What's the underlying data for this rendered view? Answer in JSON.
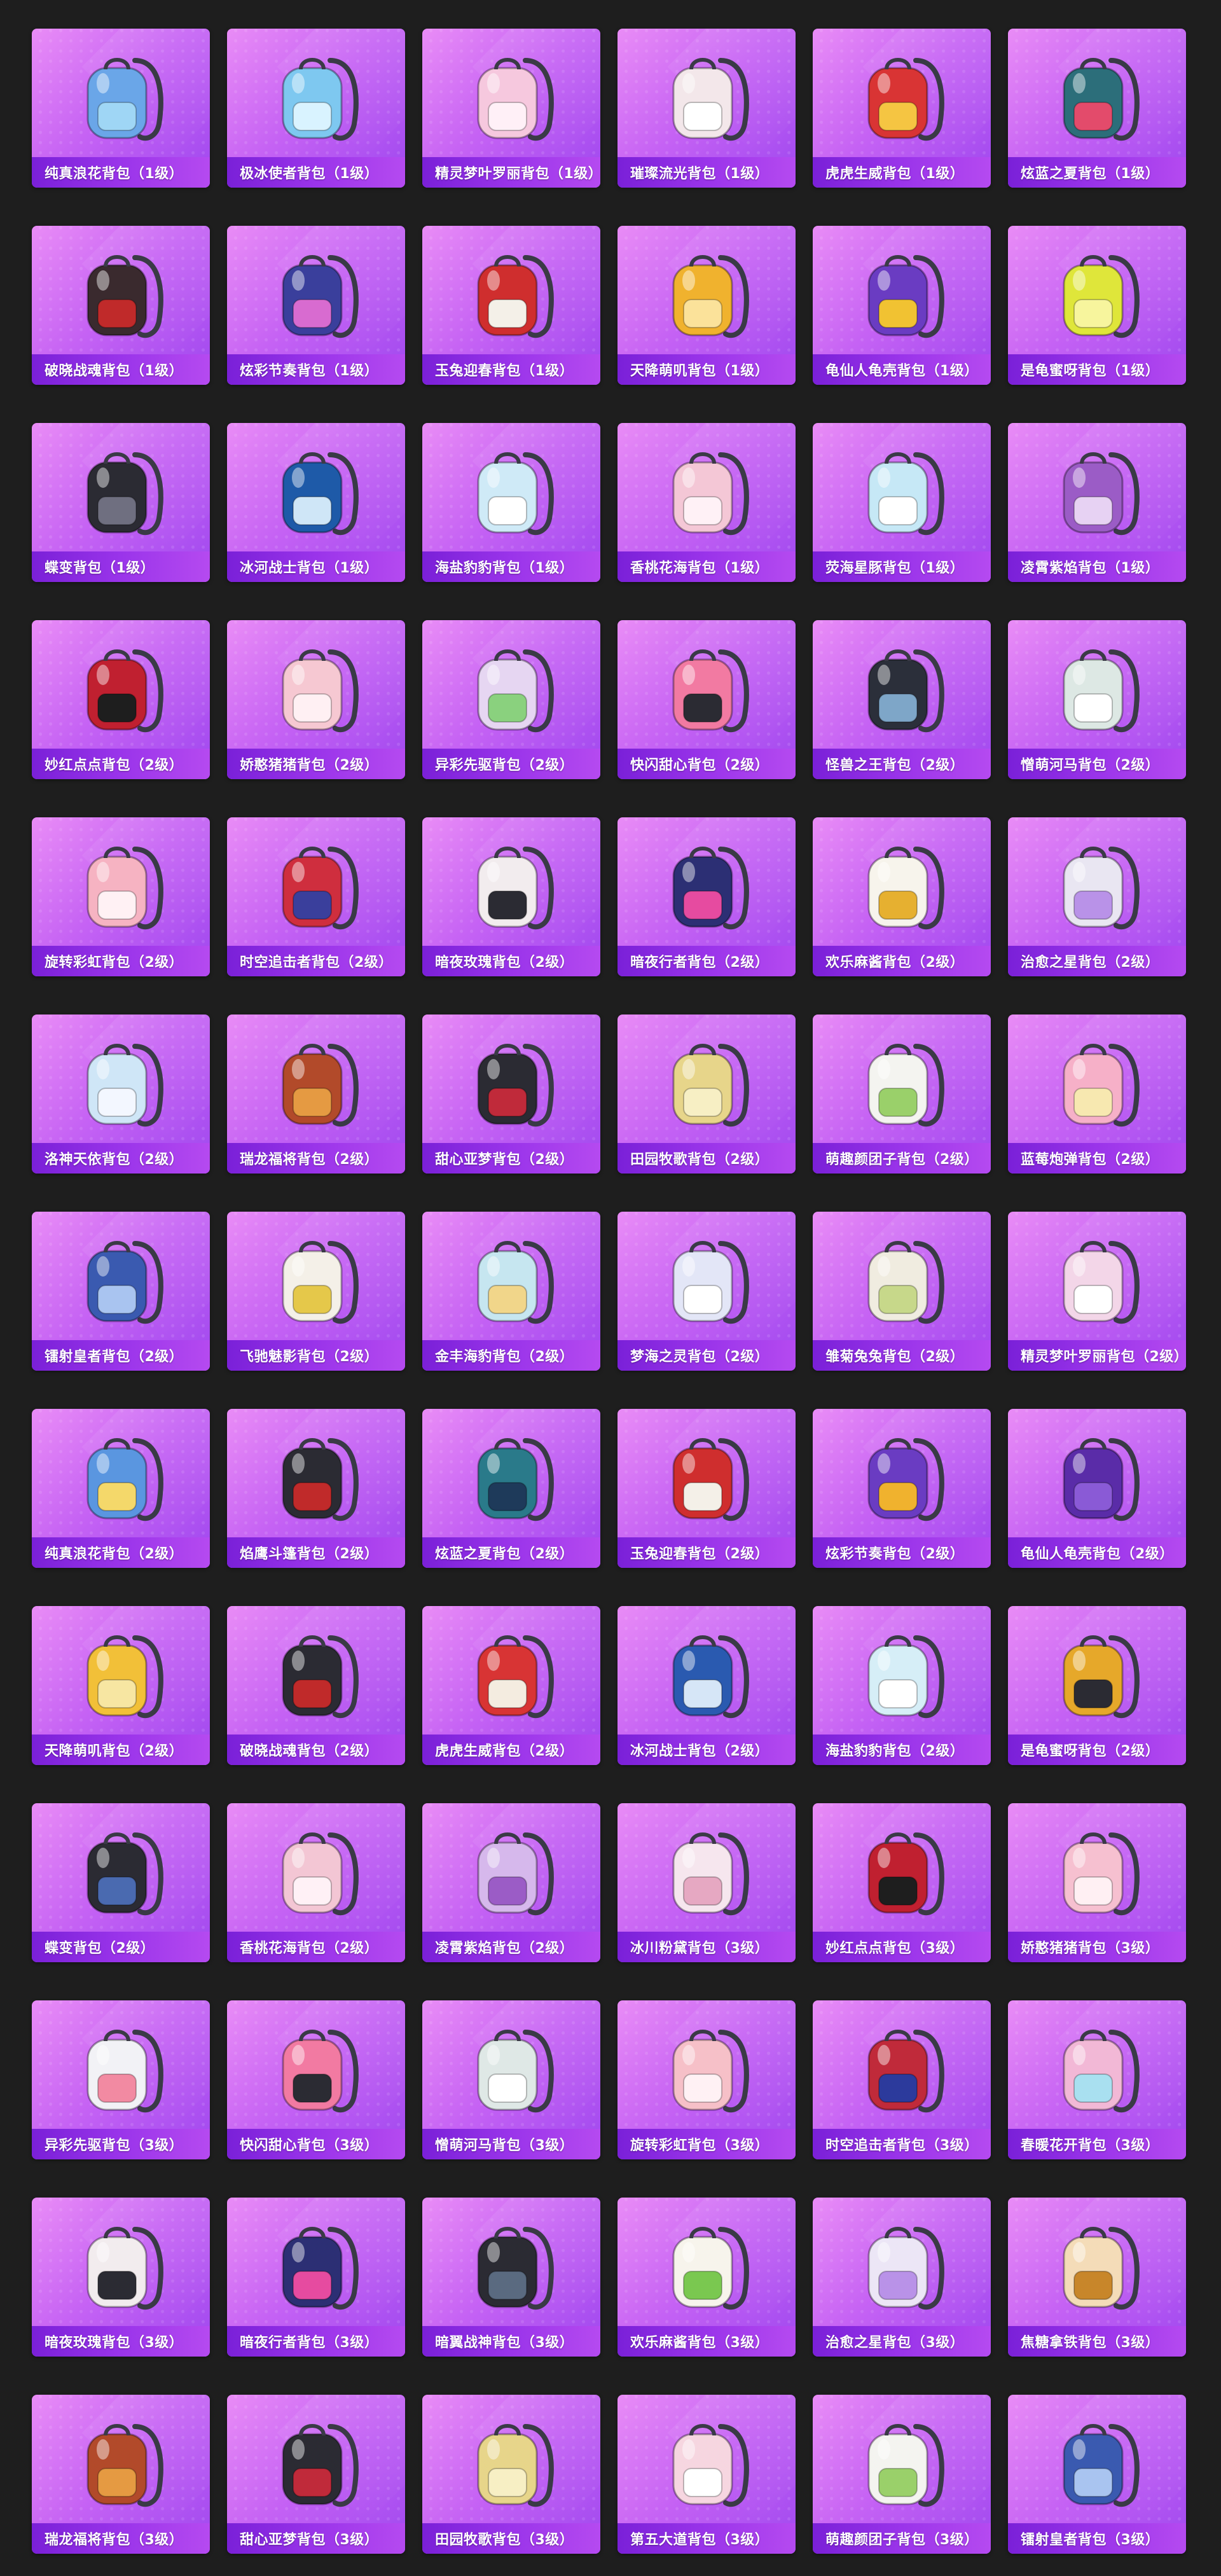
{
  "items": [
    {
      "name": "纯真浪花背包（1级）",
      "primary": "#6aa6e8",
      "secondary": "#9fd6f5"
    },
    {
      "name": "极冰使者背包（1级）",
      "primary": "#7ec8f0",
      "secondary": "#d9f3ff"
    },
    {
      "name": "精灵梦叶罗丽背包（1级）",
      "primary": "#f6c8de",
      "secondary": "#fff0f7"
    },
    {
      "name": "璀璨流光背包（1级）",
      "primary": "#f3e7ea",
      "secondary": "#ffffff"
    },
    {
      "name": "虎虎生威背包（1级）",
      "primary": "#d93434",
      "secondary": "#f5c542"
    },
    {
      "name": "炫蓝之夏背包（1级）",
      "primary": "#2c6e7a",
      "secondary": "#e34b6b"
    },
    {
      "name": "破晓战魂背包（1级）",
      "primary": "#3a2a2e",
      "secondary": "#c02a2a"
    },
    {
      "name": "炫彩节奏背包（1级）",
      "primary": "#3a3f9c",
      "secondary": "#d86bd0"
    },
    {
      "name": "玉兔迎春背包（1级）",
      "primary": "#cf2e2e",
      "secondary": "#f4f0e8"
    },
    {
      "name": "天降萌叽背包（1级）",
      "primary": "#f0b22e",
      "secondary": "#fbe29a"
    },
    {
      "name": "龟仙人龟壳背包（1级）",
      "primary": "#6a3cc2",
      "secondary": "#f1c232"
    },
    {
      "name": "是龟蜜呀背包（1级）",
      "primary": "#dfe63a",
      "secondary": "#f7f59d"
    },
    {
      "name": "蝶变背包（1级）",
      "primary": "#2b2b33",
      "secondary": "#6f6f80"
    },
    {
      "name": "冰河战士背包（1级）",
      "primary": "#1e5aa8",
      "secondary": "#cfe6f7"
    },
    {
      "name": "海盐豹豹背包（1级）",
      "primary": "#cfeaf7",
      "secondary": "#ffffff"
    },
    {
      "name": "香桃花海背包（1级）",
      "primary": "#f4c7d6",
      "secondary": "#fff1f6"
    },
    {
      "name": "荧海星豚背包（1级）",
      "primary": "#c6e8f6",
      "secondary": "#ffffff"
    },
    {
      "name": "凌霄紫焰背包（1级）",
      "primary": "#9b5cc6",
      "secondary": "#e7d2f3"
    },
    {
      "name": "妙红点点背包（2级）",
      "primary": "#c02030",
      "secondary": "#1e1e1e"
    },
    {
      "name": "娇憨猪猪背包（2级）",
      "primary": "#f6c8d2",
      "secondary": "#fff0f3"
    },
    {
      "name": "异彩先驱背包（2级）",
      "primary": "#e6d6f2",
      "secondary": "#8ad17e"
    },
    {
      "name": "快闪甜心背包（2级）",
      "primary": "#f27aa2",
      "secondary": "#2b2b33"
    },
    {
      "name": "怪兽之王背包（2级）",
      "primary": "#2b2f3a",
      "secondary": "#7ea6c8"
    },
    {
      "name": "憎萌河马背包（2级）",
      "primary": "#dde8e4",
      "secondary": "#ffffff"
    },
    {
      "name": "旋转彩虹背包（2级）",
      "primary": "#f6b3c2",
      "secondary": "#fff1f4"
    },
    {
      "name": "时空追击者背包（2级）",
      "primary": "#cf2e3e",
      "secondary": "#3a3f9c"
    },
    {
      "name": "暗夜玫瑰背包（2级）",
      "primary": "#f2ecee",
      "secondary": "#2b2b33"
    },
    {
      "name": "暗夜行者背包（2级）",
      "primary": "#2c2f74",
      "secondary": "#e64ba0"
    },
    {
      "name": "欢乐麻酱背包（2级）",
      "primary": "#f7f4ec",
      "secondary": "#e6b030"
    },
    {
      "name": "治愈之星背包（2级）",
      "primary": "#e9e6f2",
      "secondary": "#b992e8"
    },
    {
      "name": "洛神天依背包（2级）",
      "primary": "#cfe6f7",
      "secondary": "#f3f7ff"
    },
    {
      "name": "瑞龙福将背包（2级）",
      "primary": "#b24a2a",
      "secondary": "#e59a42"
    },
    {
      "name": "甜心亚梦背包（2级）",
      "primary": "#2b2b33",
      "secondary": "#c02a3a"
    },
    {
      "name": "田园牧歌背包（2级）",
      "primary": "#e7d58a",
      "secondary": "#f7efc4"
    },
    {
      "name": "萌趣颜团子背包（2级）",
      "primary": "#f4f4f0",
      "secondary": "#9ad06a"
    },
    {
      "name": "蓝莓炮弹背包（2级）",
      "primary": "#f6b0c8",
      "secondary": "#f7e8b0"
    },
    {
      "name": "镭射皇者背包（2级）",
      "primary": "#3a5ab0",
      "secondary": "#a9c4f0"
    },
    {
      "name": "飞驰魅影背包（2级）",
      "primary": "#f4f0e8",
      "secondary": "#e5c84a"
    },
    {
      "name": "金丰海豹背包（2级）",
      "primary": "#c6e6f0",
      "secondary": "#f1d68a"
    },
    {
      "name": "梦海之灵背包（2级）",
      "primary": "#e3e6f7",
      "secondary": "#ffffff"
    },
    {
      "name": "雏菊兔兔背包（2级）",
      "primary": "#f0ece0",
      "secondary": "#c7d88a"
    },
    {
      "name": "精灵梦叶罗丽背包（2级）",
      "primary": "#f3d6e8",
      "secondary": "#ffffff"
    },
    {
      "name": "纯真浪花背包（2级）",
      "primary": "#5a96e0",
      "secondary": "#f4d86a"
    },
    {
      "name": "焰鹰斗篷背包（2级）",
      "primary": "#2b2b33",
      "secondary": "#c02a2a"
    },
    {
      "name": "炫蓝之夏背包（2级）",
      "primary": "#2a7a8a",
      "secondary": "#1e3a5a"
    },
    {
      "name": "玉兔迎春背包（2级）",
      "primary": "#cf2e2e",
      "secondary": "#f4f0e8"
    },
    {
      "name": "炫彩节奏背包（2级）",
      "primary": "#6a3cc2",
      "secondary": "#f0b22e"
    },
    {
      "name": "龟仙人龟壳背包（2级）",
      "primary": "#5a2ca8",
      "secondary": "#8a5ad6"
    },
    {
      "name": "天降萌叽背包（2级）",
      "primary": "#f2c038",
      "secondary": "#f7e6a2"
    },
    {
      "name": "破晓战魂背包（2级）",
      "primary": "#2b2b33",
      "secondary": "#c02a2a"
    },
    {
      "name": "虎虎生威背包（2级）",
      "primary": "#d83434",
      "secondary": "#f4ece0"
    },
    {
      "name": "冰河战士背包（2级）",
      "primary": "#2a5ab0",
      "secondary": "#d6e6f7"
    },
    {
      "name": "海盐豹豹背包（2级）",
      "primary": "#d6eef7",
      "secondary": "#ffffff"
    },
    {
      "name": "是龟蜜呀背包（2级）",
      "primary": "#e6a82a",
      "secondary": "#2b2b33"
    },
    {
      "name": "蝶变背包（2级）",
      "primary": "#2b2b33",
      "secondary": "#4a6ab0"
    },
    {
      "name": "香桃花海背包（2级）",
      "primary": "#f3c6d4",
      "secondary": "#fff1f6"
    },
    {
      "name": "凌霄紫焰背包（2级）",
      "primary": "#d6b8ec",
      "secondary": "#9b5cc6"
    },
    {
      "name": "冰川粉黛背包（3级）",
      "primary": "#f6e6ee",
      "secondary": "#e6a8c2"
    },
    {
      "name": "妙红点点背包（3级）",
      "primary": "#c02030",
      "secondary": "#1e1e1e"
    },
    {
      "name": "娇憨猪猪背包（3级）",
      "primary": "#f6c0d0",
      "secondary": "#fff0f3"
    },
    {
      "name": "异彩先驱背包（3级）",
      "primary": "#f2f2f6",
      "secondary": "#f28aa2"
    },
    {
      "name": "快闪甜心背包（3级）",
      "primary": "#f27aa2",
      "secondary": "#2b2b33"
    },
    {
      "name": "憎萌河马背包（3级）",
      "primary": "#dfe8e6",
      "secondary": "#ffffff"
    },
    {
      "name": "旋转彩虹背包（3级）",
      "primary": "#f6c0c8",
      "secondary": "#fff1f4"
    },
    {
      "name": "时空追击者背包（3级）",
      "primary": "#c02a3a",
      "secondary": "#2c3a9c"
    },
    {
      "name": "春暖花开背包（3级）",
      "primary": "#f2b8d6",
      "secondary": "#a9e0f0"
    },
    {
      "name": "暗夜玫瑰背包（3级）",
      "primary": "#f2ecee",
      "secondary": "#2b2b33"
    },
    {
      "name": "暗夜行者背包（3级）",
      "primary": "#2c2f74",
      "secondary": "#e64ba0"
    },
    {
      "name": "暗翼战神背包（3级）",
      "primary": "#2b2b33",
      "secondary": "#5a6a80"
    },
    {
      "name": "欢乐麻酱背包（3级）",
      "primary": "#f7f4ec",
      "secondary": "#7ac850"
    },
    {
      "name": "治愈之星背包（3级）",
      "primary": "#ece6f6",
      "secondary": "#b992e8"
    },
    {
      "name": "焦糖拿铁背包（3级）",
      "primary": "#f4dcb8",
      "secondary": "#c8862a"
    },
    {
      "name": "瑞龙福将背包（3级）",
      "primary": "#b24a2a",
      "secondary": "#e59a42"
    },
    {
      "name": "甜心亚梦背包（3级）",
      "primary": "#2b2b33",
      "secondary": "#c02a3a"
    },
    {
      "name": "田园牧歌背包（3级）",
      "primary": "#e7d58a",
      "secondary": "#f7efc4"
    },
    {
      "name": "第五大道背包（3级）",
      "primary": "#f6d6e0",
      "secondary": "#ffffff"
    },
    {
      "name": "萌趣颜团子背包（3级）",
      "primary": "#f4f4f0",
      "secondary": "#9ad06a"
    },
    {
      "name": "镭射皇者背包（3级）",
      "primary": "#3a5ab0",
      "secondary": "#a9c4f0"
    }
  ]
}
